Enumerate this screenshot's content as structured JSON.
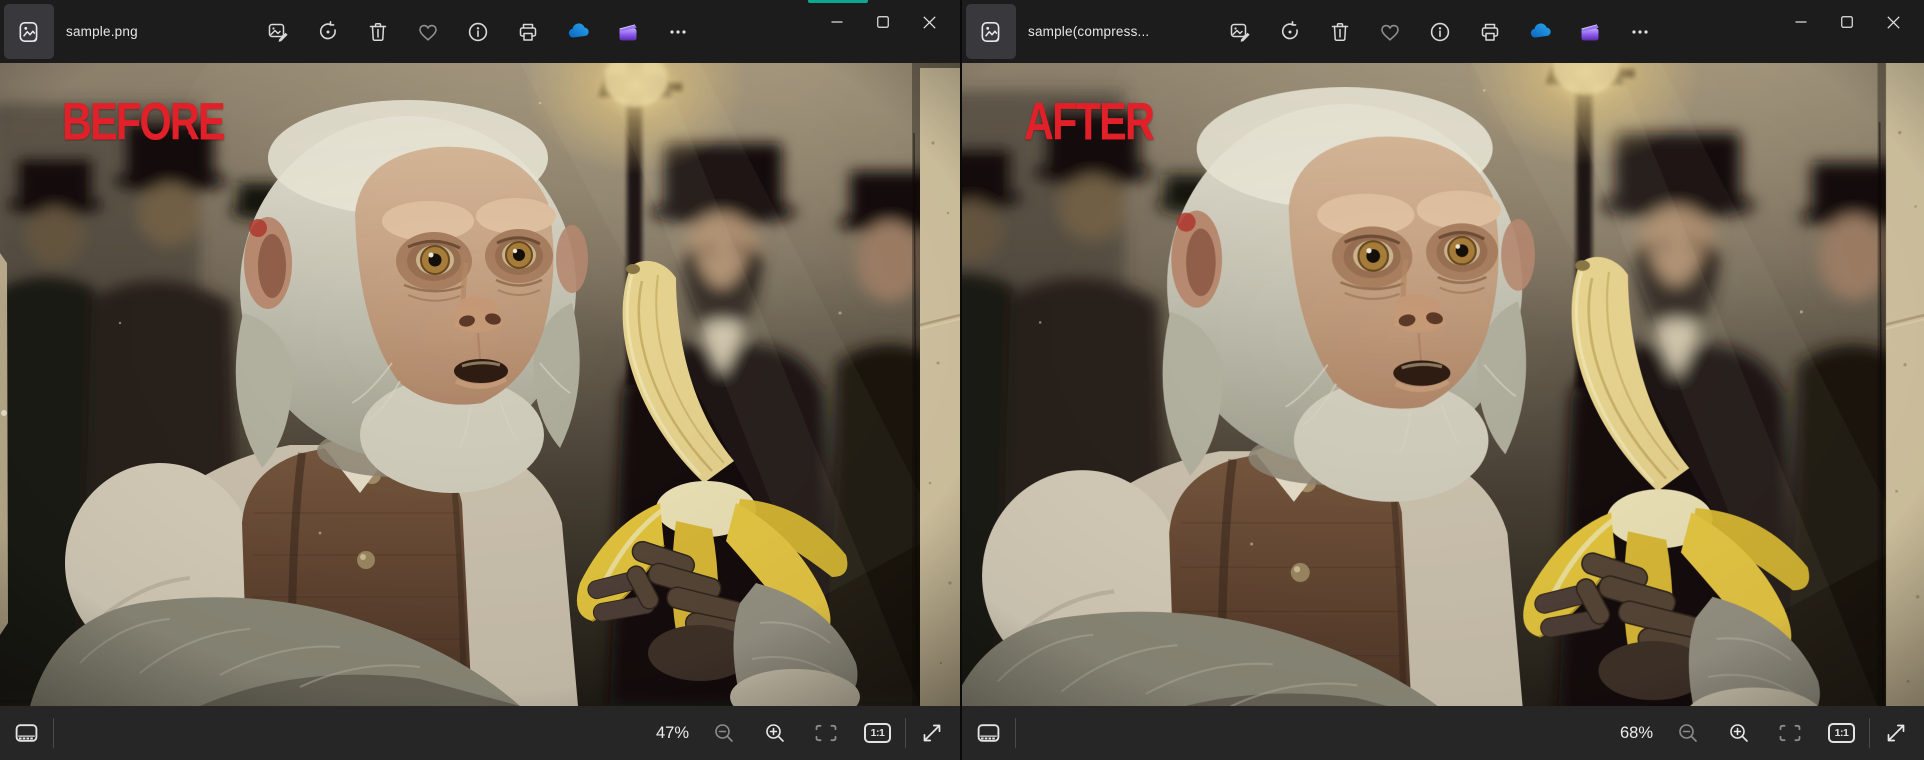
{
  "desktop": {
    "accent_strip_color": "#0da98e"
  },
  "windows": [
    {
      "app": "Photos",
      "titlebar": {
        "filename": "sample.png",
        "toolbar_icons": [
          "edit-image",
          "rotate",
          "delete",
          "add-to-favourites",
          "file-information",
          "print",
          "view-onedrive",
          "edit-with-clipchamp",
          "see-more"
        ],
        "window_controls": [
          "minimize",
          "maximize",
          "close"
        ]
      },
      "photo": {
        "overlay_label": "BEFORE"
      },
      "statusbar": {
        "zoom_level": "47%",
        "actual_size_label": "1:1",
        "icons": [
          "filmstrip-pane",
          "zoom-out",
          "zoom-in",
          "fit-to-window",
          "actual-size",
          "fullscreen"
        ]
      }
    },
    {
      "app": "Photos",
      "titlebar": {
        "filename": "sample(compress...",
        "toolbar_icons": [
          "edit-image",
          "rotate",
          "delete",
          "add-to-favourites",
          "file-information",
          "print",
          "view-onedrive",
          "edit-with-clipchamp",
          "see-more"
        ],
        "window_controls": [
          "minimize",
          "maximize",
          "close"
        ]
      },
      "photo": {
        "overlay_label": "AFTER"
      },
      "statusbar": {
        "zoom_level": "68%",
        "actual_size_label": "1:1",
        "icons": [
          "filmstrip-pane",
          "zoom-out",
          "zoom-in",
          "fit-to-window",
          "actual-size",
          "fullscreen"
        ]
      }
    }
  ]
}
